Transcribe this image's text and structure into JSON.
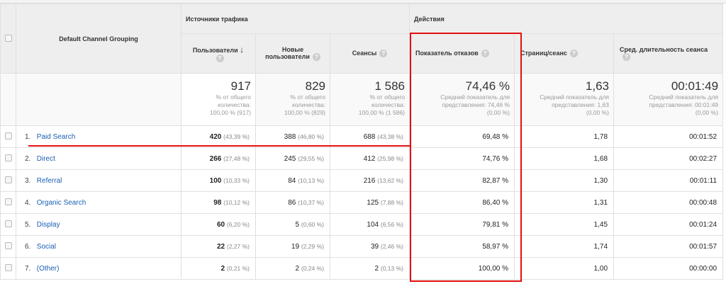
{
  "header": {
    "dimension": "Default Channel Grouping",
    "group_traffic": "Источники трафика",
    "group_actions": "Действия",
    "cols": [
      "Пользователи",
      "Новые пользователи",
      "Сеансы",
      "Показатель отказов",
      "Страниц/сеанс",
      "Сред. длительность сеанса"
    ],
    "sort_icon": "↓",
    "help_icon": "?"
  },
  "totals": [
    {
      "value": "917",
      "l1": "% от общего",
      "l2": "количества:",
      "l3": "100,00 % (917)"
    },
    {
      "value": "829",
      "l1": "% от общего",
      "l2": "количества:",
      "l3": "100,00 % (829)"
    },
    {
      "value": "1 586",
      "l1": "% от общего",
      "l2": "количества:",
      "l3": "100,00 % (1 586)"
    },
    {
      "value": "74,46 %",
      "l1": "Средний показатель для",
      "l2": "представления: 74,46 %",
      "l3": "(0,00 %)"
    },
    {
      "value": "1,63",
      "l1": "Средний показатель для",
      "l2": "представления: 1,63",
      "l3": "(0,00 %)"
    },
    {
      "value": "00:01:49",
      "l1": "Средний показатель для",
      "l2": "представления: 00:01:49",
      "l3": "(0,00 %)"
    }
  ],
  "rows": [
    {
      "n": "1.",
      "name": "Paid Search",
      "users": "420",
      "users_pct": "(43,39 %)",
      "new": "388",
      "new_pct": "(46,80 %)",
      "sessions": "688",
      "sessions_pct": "(43,38 %)",
      "bounce": "69,48 %",
      "pages": "1,78",
      "duration": "00:01:52"
    },
    {
      "n": "2.",
      "name": "Direct",
      "users": "266",
      "users_pct": "(27,48 %)",
      "new": "245",
      "new_pct": "(29,55 %)",
      "sessions": "412",
      "sessions_pct": "(25,98 %)",
      "bounce": "74,76 %",
      "pages": "1,68",
      "duration": "00:02:27"
    },
    {
      "n": "3.",
      "name": "Referral",
      "users": "100",
      "users_pct": "(10,33 %)",
      "new": "84",
      "new_pct": "(10,13 %)",
      "sessions": "216",
      "sessions_pct": "(13,62 %)",
      "bounce": "82,87 %",
      "pages": "1,30",
      "duration": "00:01:11"
    },
    {
      "n": "4.",
      "name": "Organic Search",
      "users": "98",
      "users_pct": "(10,12 %)",
      "new": "86",
      "new_pct": "(10,37 %)",
      "sessions": "125",
      "sessions_pct": "(7,88 %)",
      "bounce": "86,40 %",
      "pages": "1,31",
      "duration": "00:00:48"
    },
    {
      "n": "5.",
      "name": "Display",
      "users": "60",
      "users_pct": "(6,20 %)",
      "new": "5",
      "new_pct": "(0,60 %)",
      "sessions": "104",
      "sessions_pct": "(6,56 %)",
      "bounce": "79,81 %",
      "pages": "1,45",
      "duration": "00:01:24"
    },
    {
      "n": "6.",
      "name": "Social",
      "users": "22",
      "users_pct": "(2,27 %)",
      "new": "19",
      "new_pct": "(2,29 %)",
      "sessions": "39",
      "sessions_pct": "(2,46 %)",
      "bounce": "58,97 %",
      "pages": "1,74",
      "duration": "00:01:57"
    },
    {
      "n": "7.",
      "name": "(Other)",
      "users": "2",
      "users_pct": "(0,21 %)",
      "new": "2",
      "new_pct": "(0,24 %)",
      "sessions": "2",
      "sessions_pct": "(0,13 %)",
      "bounce": "100,00 %",
      "pages": "1,00",
      "duration": "00:00:00"
    }
  ]
}
